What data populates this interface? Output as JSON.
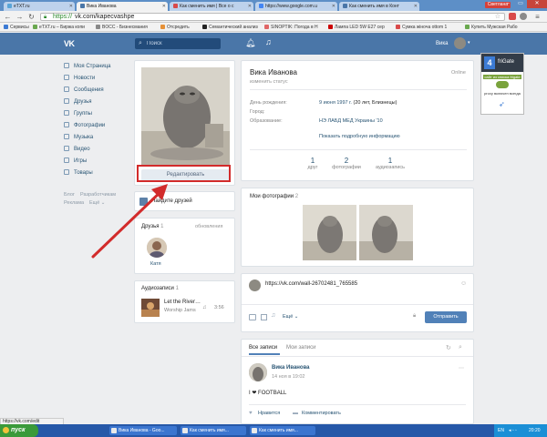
{
  "browser": {
    "tabs": [
      {
        "label": "eTXT.ru",
        "favicon_color": "#5aa5d8"
      },
      {
        "label": "Вика Иванова",
        "favicon_color": "#4a76a8"
      },
      {
        "label": "Как сменить имя | Все о с",
        "favicon_color": "#d94a4a"
      },
      {
        "label": "https://www.google.com.u",
        "favicon_color": "#4285f4"
      },
      {
        "label": "Как сменить имя в Конт",
        "favicon_color": "#4a76a8"
      }
    ],
    "profile_tag": "Светлана",
    "window_controls": [
      "–",
      "▭",
      "✕"
    ],
    "url_scheme": "https://",
    "url_rest": "vk.com/kapecvashpe",
    "bookmarks": [
      {
        "label": "Сервисы",
        "color": "#3c7bd4"
      },
      {
        "label": "eTXT.ru – Биржа копи",
        "color": "#6aa84f"
      },
      {
        "label": "BOCC - Бизнесмания",
        "color": "#888888"
      },
      {
        "label": "Отсредить",
        "color": "#e69138"
      },
      {
        "label": "Семантический анализ",
        "color": "#222222"
      },
      {
        "label": "SINOPTIK: Погода в Н",
        "color": "#e06666"
      },
      {
        "label": "Лампа LED 5W E27 сер",
        "color": "#cc0000"
      },
      {
        "label": "Сумка жіноча ottom 1",
        "color": "#d94a4a"
      },
      {
        "label": "Купить Мужская Рабо",
        "color": "#6aa84f"
      }
    ]
  },
  "vk_header": {
    "logo": "VK",
    "search_placeholder": "Поиск",
    "user_name": "Вика"
  },
  "left_menu": {
    "items": [
      "Моя Страница",
      "Новости",
      "Сообщения",
      "Друзья",
      "Группы",
      "Фотографии",
      "Музыка",
      "Видео",
      "Игры",
      "Товары"
    ],
    "footer_row1": [
      "Блог",
      "Разработчикам"
    ],
    "footer_row2": [
      "Реклама",
      "Ещё ⌄"
    ]
  },
  "profile": {
    "edit_button": "Редактировать",
    "friends_hint": "Найдите друзей",
    "name": "Вика Иванова",
    "status_placeholder": "изменить статус",
    "online": "Online",
    "info": [
      {
        "label": "День рождения:",
        "value_link": "9 июня 1997 г.",
        "value_text": " (20 лет, Близнецы)"
      },
      {
        "label": "Город:",
        "value_link": "",
        "value_text": ""
      },
      {
        "label": "Образование:",
        "value_link": "НЭ ЛАБД МЕД Украины '10",
        "value_text": ""
      }
    ],
    "more_info": "Показать подробную информацию",
    "counters": [
      {
        "num": "1",
        "label": "друг"
      },
      {
        "num": "2",
        "label": "фотографии"
      },
      {
        "num": "1",
        "label": "аудиозапись"
      }
    ]
  },
  "friends": {
    "title": "Друзья",
    "count": "1",
    "updates": "обновления",
    "items": [
      {
        "name": "Катя"
      }
    ]
  },
  "audio": {
    "title": "Аудиозаписи",
    "count": "1",
    "track": {
      "title": "Let the River…",
      "artist": "Worship Jams",
      "duration": "3:56"
    }
  },
  "photos": {
    "title": "Мои фотографии",
    "count": "2"
  },
  "composer": {
    "text": "https://vk.com/wall-26702481_765585",
    "more": "Ещё ⌄",
    "submit": "Отправить"
  },
  "wall": {
    "tabs": [
      "Все записи",
      "Мои записи"
    ],
    "post": {
      "author": "Вика Иванова",
      "date": "14 ноя в 19:02",
      "text": "I ❤ FOOTBALL",
      "like": "Нравится",
      "comment": "Комментировать"
    }
  },
  "frigate": {
    "title": "friGate",
    "line1": "сайт из списка frigate",
    "line2": "proxy включен всегда",
    "accent": "#3c7bd4"
  },
  "statusbar": "https://vk.com/edit",
  "taskbar": {
    "start": "пуск",
    "tasks": [
      "Вика Иванова - Goo...",
      "Как сменить имя...",
      "Как сменить имя..."
    ],
    "lang": "EN",
    "time": "20:20"
  },
  "annotation": {
    "color": "#d22b2b"
  }
}
